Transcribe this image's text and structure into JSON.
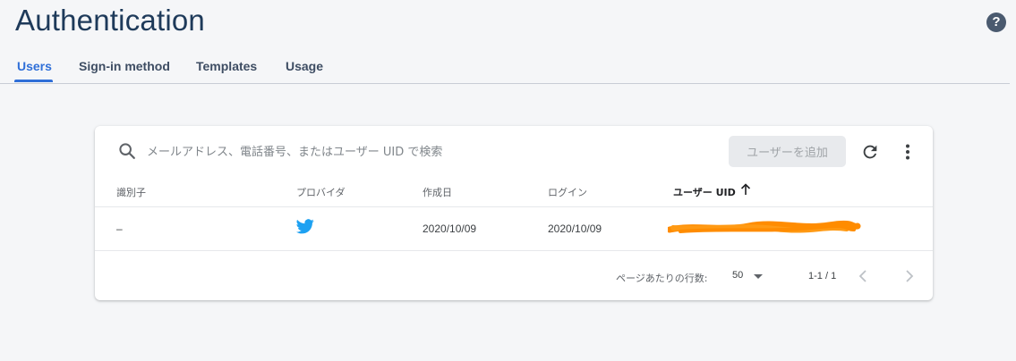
{
  "header": {
    "title": "Authentication",
    "help_icon": "help-icon",
    "help_glyph": "?"
  },
  "tabs": [
    {
      "label": "Users",
      "active": true
    },
    {
      "label": "Sign-in method",
      "active": false
    },
    {
      "label": "Templates",
      "active": false
    },
    {
      "label": "Usage",
      "active": false
    }
  ],
  "colors": {
    "accent": "#2f6fd8",
    "title": "#1e3a5a",
    "twitter": "#1da1f2",
    "redaction": "#ff8c00"
  },
  "search": {
    "placeholder": "メールアドレス、電話番号、またはユーザー UID で検索",
    "value": "",
    "icon": "search-icon"
  },
  "toolbar": {
    "add_user_label": "ユーザーを追加",
    "refresh_icon": "refresh-icon",
    "more_icon": "more-vert-icon"
  },
  "table": {
    "columns": [
      {
        "label": "識別子"
      },
      {
        "label": "プロバイダ"
      },
      {
        "label": "作成日"
      },
      {
        "label": "ログイン"
      },
      {
        "label": "ユーザー UID",
        "sorted": "ascending"
      }
    ],
    "rows": [
      {
        "identifier": "–",
        "provider": "twitter-icon",
        "created": "2020/10/09",
        "signed_in": "2020/10/09",
        "uid": "redacted"
      }
    ]
  },
  "pagination": {
    "rows_per_page_label": "ページあたりの行数:",
    "rows_per_page": "50",
    "range": "1-1 / 1"
  }
}
